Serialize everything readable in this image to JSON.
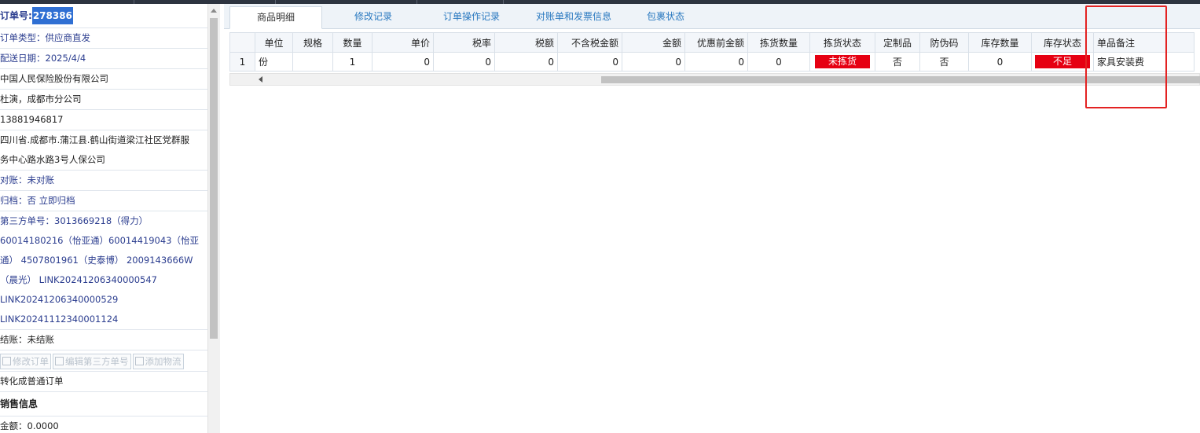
{
  "left": {
    "order_no_label": "订单号:",
    "order_no_value": "278386",
    "rows": [
      "订单类型：供应商直发",
      "配送日期：2025/4/4",
      "中国人民保险股份有限公司",
      "杜演，成都市分公司",
      "13881946817",
      "四川省.成都市.蒲江县.鹤山街道梁江社区党群服",
      "务中心路水路3号人保公司",
      "对账：未对账",
      "归档：否 立即归档",
      "第三方单号：3013669218（得力）",
      "60014180216（怡亚通）60014419043（怡亚",
      "通） 4507801961（史泰博） 2009143666W",
      "（晨光） LINK20241206340000547",
      "LINK20241206340000529",
      "LINK20241112340001124",
      "结账：未结账"
    ],
    "buttons": {
      "edit_order": "修改订单",
      "edit_third": "编辑第三方单号",
      "add_logistics": "添加物流"
    },
    "convert": "转化成普通订单",
    "sales_section": "销售信息",
    "amount": "金额：0.0000"
  },
  "tabs": [
    "商品明细",
    "修改记录",
    "订单操作记录",
    "对账单和发票信息",
    "包裹状态"
  ],
  "table": {
    "headers": [
      "单位",
      "规格",
      "数量",
      "单价",
      "税率",
      "税额",
      "不含税金额",
      "金额",
      "优惠前金额",
      "拣货数量",
      "拣货状态",
      "定制品",
      "防伪码",
      "库存数量",
      "库存状态",
      "单品备注"
    ],
    "row": {
      "rn": "1",
      "unit": "份",
      "spec": "",
      "qty": "1",
      "price": "0",
      "tax_rate": "0",
      "tax": "0",
      "untaxed": "0",
      "amount": "0",
      "pre_discount": "0",
      "pick_qty": "0",
      "pick_status": "未拣货",
      "custom": "否",
      "anti_fake": "否",
      "stock_qty": "0",
      "stock_status": "不足",
      "remark": "家具安装费"
    }
  },
  "colors": {
    "accent": "#2f6fd3",
    "link": "#2a79c0",
    "alert": "#e60012",
    "annotation": "#e32222"
  }
}
